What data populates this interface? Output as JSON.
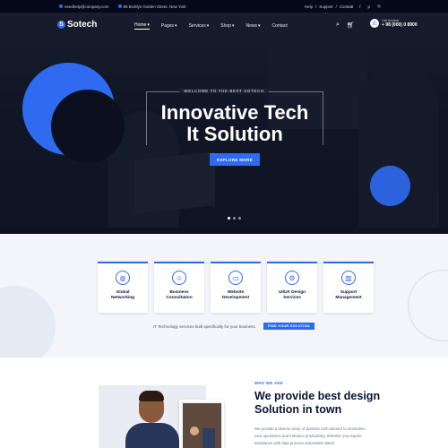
{
  "topbar": {
    "email": "needhelp@company.com",
    "address": "88 Broklyn Golden Street. New York",
    "links": [
      "Help",
      "Support",
      "Contact"
    ],
    "socials": [
      "twitter-icon",
      "facebook-icon",
      "pinterest-icon",
      "instagram-icon"
    ]
  },
  "brand": {
    "name": "Sotech"
  },
  "nav": {
    "items": [
      "Home",
      "Pages",
      "Services",
      "Shop",
      "News",
      "Contact"
    ]
  },
  "call": {
    "label": "Call Anytime",
    "number": "+ 98 (000) 0 8900"
  },
  "hero": {
    "eyebrow": "WELCOME TO THE BEST SOTECH",
    "headline_line1": "Innovative Tech",
    "headline_line2": "It Solution",
    "cta": "EXPLORE MORE",
    "slide_count": 3,
    "active_slide": 1
  },
  "services": {
    "cards": [
      {
        "icon": "globe-icon",
        "line1": "Global",
        "line2": "Networking"
      },
      {
        "icon": "consult-icon",
        "line1": "Business",
        "line2": "Consultation"
      },
      {
        "icon": "monitor-icon",
        "line1": "Website",
        "line2": "Development"
      },
      {
        "icon": "gear-icon",
        "line1": "UI/UX Design",
        "line2": "Services"
      },
      {
        "icon": "chart-icon",
        "line1": "Support",
        "line2": "Management"
      }
    ],
    "tagline": "IT Technology services built specifically for your business.",
    "cta": "FIND YOUR SOLUTION"
  },
  "about": {
    "eyebrow": "WHO WE ARE",
    "title_line1": "We provide best design",
    "title_line2": "Solution in town",
    "text_line1": "We provide a diverse array of dynamic tech tailored to streamline",
    "text_line2": "your operations and enhance productivity. Whether you require",
    "text_line3": "assistance with data process automation latest"
  },
  "colors": {
    "accent": "#2f6bf0",
    "dark": "#06091a",
    "light_bg": "#f3f5fa"
  }
}
